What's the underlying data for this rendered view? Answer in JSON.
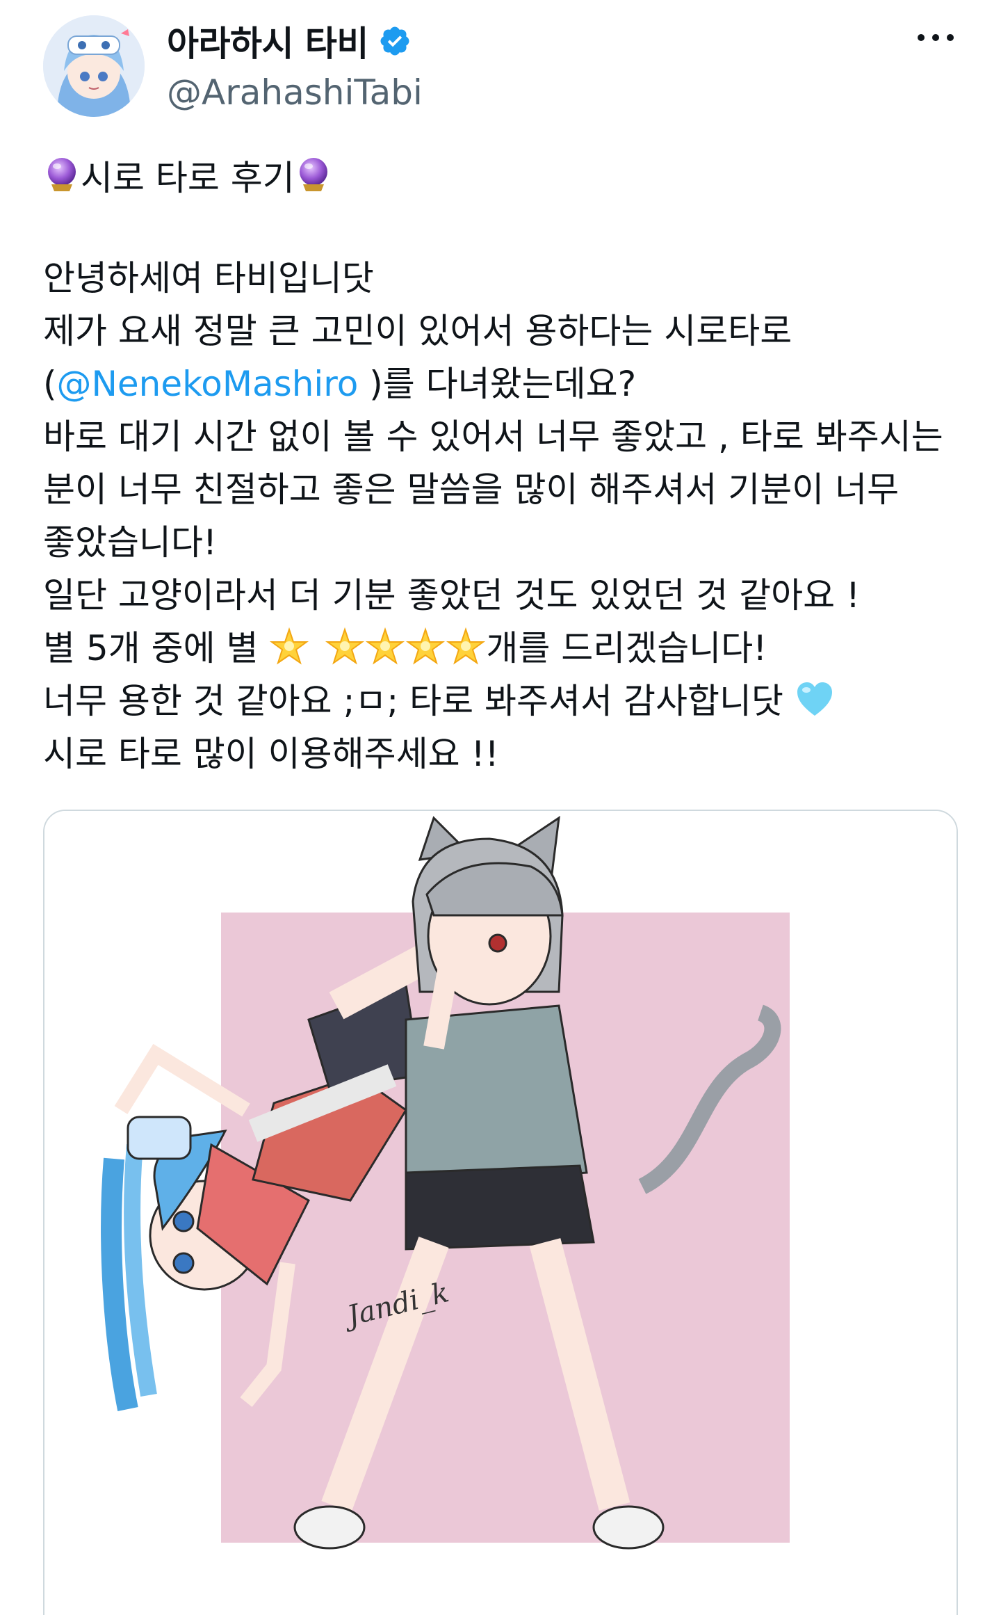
{
  "author": {
    "display_name": "아라하시 타비",
    "handle": "@ArahashiTabi",
    "verified": true,
    "verified_color": "#1d9bf0"
  },
  "menu": {
    "more_icon": "more-horizontal-icon"
  },
  "tweet": {
    "title": "시로 타로 후기",
    "title_icon": "crystal-ball-emoji",
    "lines": {
      "l1": "안녕하세여 타비입니닷",
      "l2": "제가 요새 정말 큰 고민이 있어서 용하다는 시로타로",
      "l3_pre": "(",
      "l3_mention": "@NenekoMashiro",
      "l3_post": " )를 다녀왔는데요?",
      "l4": "바로 대기 시간 없이 볼 수 있어서 너무 좋았고 , 타로 봐주시는",
      "l5": "분이 너무 친절하고 좋은 말씀을 많이 해주셔서 기분이 너무",
      "l6": "좋았습니다!",
      "l7": "일단 고양이라서 더 기분 좋았던 것도 있었던 것 같아요 !",
      "l8_pre": " 별 5개 중에 별 ",
      "l8_post": "개를 드리겠습니다!",
      "l9": "너무 용한 것 같아요 ;ㅁ; 타로 봐주셔서 감사합니닷 ",
      "l10": "시로 타로 많이 이용해주세요 !!"
    },
    "mention_color": "#1d9bf0",
    "star_rating": {
      "icon": "glowing-star-emoji",
      "count_shown": 5
    },
    "heart_icon": "light-blue-heart-emoji"
  },
  "media": {
    "description_icon": "illustration-image",
    "signature": "Jandi_k",
    "background_color": "#ebc8d7"
  }
}
